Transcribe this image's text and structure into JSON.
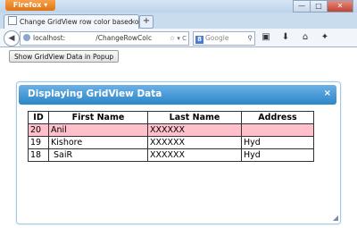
{
  "browser": {
    "menu_label": "Firefox",
    "window_controls": [
      "—",
      "□",
      "✕"
    ],
    "tab_title": "Change GridView row color based on co...",
    "tab_close": "×",
    "new_tab": "+",
    "url_host": "localhost:",
    "url_path": "/ChangeRowColc",
    "url_controls": "☆ ▾ C",
    "search_placeholder": "Google",
    "search_engine_letter": "8"
  },
  "page": {
    "popup_button": "Show GridView Data in Popup",
    "dialog": {
      "title": "Displaying GridView Data",
      "close": "×",
      "table": {
        "headers": [
          "ID",
          "First Name",
          "Last Name",
          "Address"
        ],
        "rows": [
          {
            "id": "20",
            "first": "Anil",
            "last": "XXXXXX",
            "address": "",
            "highlighted": true
          },
          {
            "id": "19",
            "first": "Kishore",
            "last": "XXXXXX",
            "address": "Hyd",
            "highlighted": false
          },
          {
            "id": "18",
            "first": " SaiR",
            "last": "XXXXXX",
            "address": "Hyd",
            "highlighted": false
          }
        ]
      }
    }
  },
  "colors": {
    "dialog_header": "#2b86c8",
    "highlight_row": "#ffc0cb",
    "firefox_button": "#e07312"
  }
}
